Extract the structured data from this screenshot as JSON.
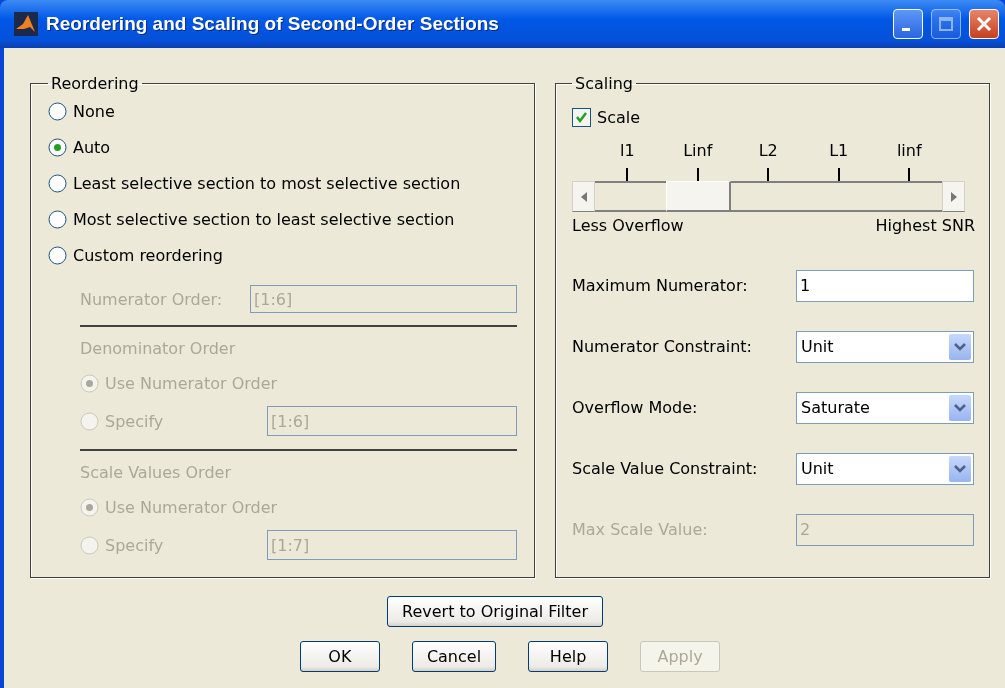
{
  "window": {
    "title": "Reordering and Scaling of Second-Order Sections"
  },
  "reordering": {
    "title": "Reordering",
    "options": [
      {
        "label": "None",
        "selected": false
      },
      {
        "label": "Auto",
        "selected": true
      },
      {
        "label": "Least selective section to most selective section",
        "selected": false
      },
      {
        "label": "Most selective section to least selective section",
        "selected": false
      },
      {
        "label": "Custom reordering",
        "selected": false
      }
    ],
    "custom": {
      "disabled": true,
      "numerator_order": {
        "label": "Numerator Order:",
        "value": "[1:6]"
      },
      "groups": [
        {
          "title": "Denominator Order",
          "options": [
            {
              "label": "Use Numerator Order",
              "selected": true
            },
            {
              "label": "Specify",
              "selected": false
            }
          ],
          "value": "[1:6]"
        },
        {
          "title": "Scale Values Order",
          "options": [
            {
              "label": "Use Numerator Order",
              "selected": true
            },
            {
              "label": "Specify",
              "selected": false
            }
          ],
          "value": "[1:7]"
        }
      ]
    }
  },
  "scaling": {
    "title": "Scaling",
    "scale": {
      "label": "Scale",
      "checked": true
    },
    "slider": {
      "ticks": [
        "l1",
        "Linf",
        "L2",
        "L1",
        "linf"
      ],
      "level": 0.25,
      "min_label": "Less Overflow",
      "max_label": "Highest SNR"
    },
    "fields": [
      {
        "kind": "text",
        "label": "Maximum Numerator:",
        "value": "1",
        "disabled": false
      },
      {
        "kind": "dropdown",
        "label": "Numerator Constraint:",
        "value": "Unit",
        "disabled": false
      },
      {
        "kind": "dropdown",
        "label": "Overflow Mode:",
        "value": "Saturate",
        "disabled": false
      },
      {
        "kind": "dropdown",
        "label": "Scale Value Constraint:",
        "value": "Unit",
        "disabled": false
      },
      {
        "kind": "text",
        "label": "Max Scale Value:",
        "value": "2",
        "disabled": true
      }
    ]
  },
  "revert_button": {
    "label": "Revert to Original Filter",
    "disabled": false
  },
  "buttons": [
    {
      "label": "OK",
      "disabled": false
    },
    {
      "label": "Cancel",
      "disabled": false
    },
    {
      "label": "Help",
      "disabled": false
    },
    {
      "label": "Apply",
      "disabled": true
    }
  ]
}
